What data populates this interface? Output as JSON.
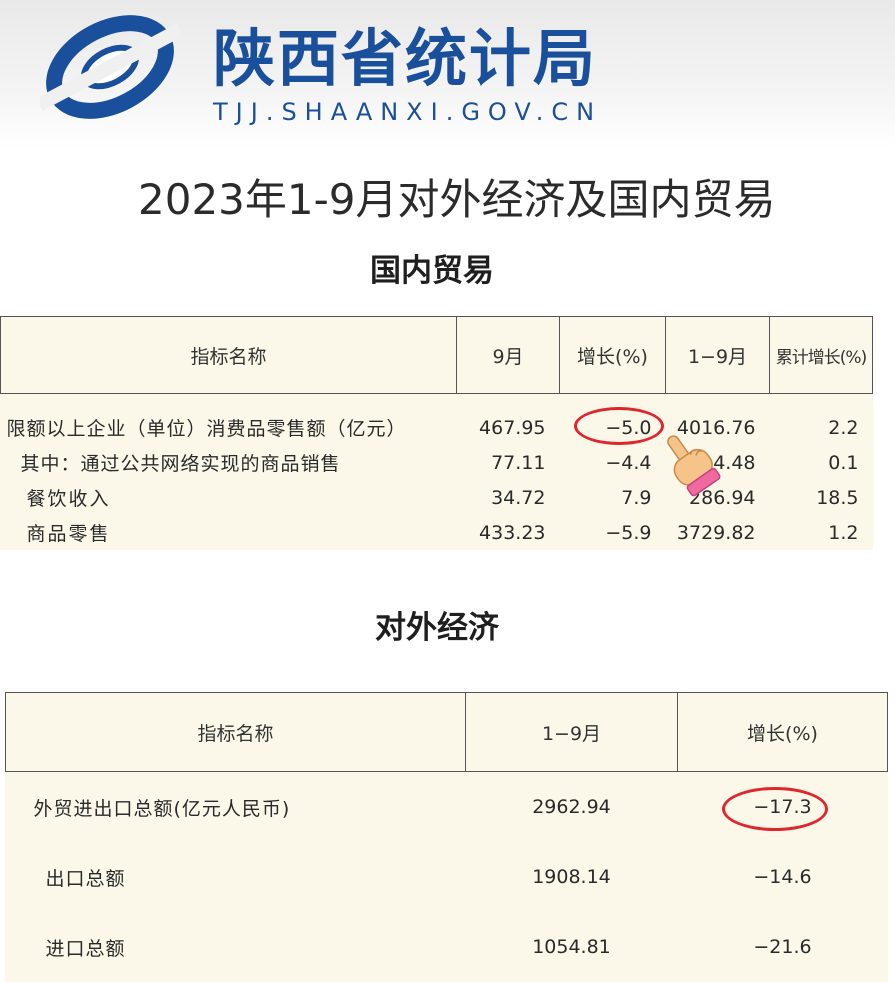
{
  "header": {
    "org_name": "陕西省统计局",
    "org_url": "TJJ.SHAANXI.GOV.CN",
    "logo_icon": "shaanxi-statistics-logo",
    "brand_color": "#1a4f9c"
  },
  "document": {
    "title": "2023年1-9月对外经济及国内贸易"
  },
  "domestic_trade": {
    "section_title": "国内贸易",
    "columns": [
      "指标名称",
      "9月",
      "增长(%)",
      "1−9月",
      "累计增长(%)"
    ],
    "rows": [
      {
        "name": "限额以上企业（单位）消费品零售额（亿元）",
        "sep": "467.95",
        "sep_growth": "−5.0",
        "ytd": "4016.76",
        "ytd_growth": "2.2"
      },
      {
        "name": "其中：通过公共网络实现的商品销售",
        "sep": "77.11",
        "sep_growth": "−4.4",
        "ytd": "714.48",
        "ytd_growth": "0.1"
      },
      {
        "name": "餐饮收入",
        "sep": "34.72",
        "sep_growth": "7.9",
        "ytd": "286.94",
        "ytd_growth": "18.5"
      },
      {
        "name": "商品零售",
        "sep": "433.23",
        "sep_growth": "−5.9",
        "ytd": "3729.82",
        "ytd_growth": "1.2"
      }
    ]
  },
  "foreign_economy": {
    "section_title": "对外经济",
    "columns": [
      "指标名称",
      "1−9月",
      "增长(%)"
    ],
    "rows": [
      {
        "name": "外贸进出口总额(亿元人民币)",
        "ytd": "2962.94",
        "growth": "−17.3"
      },
      {
        "name": "出口总额",
        "ytd": "1908.14",
        "growth": "−14.6"
      },
      {
        "name": "进口总额",
        "ytd": "1054.81",
        "growth": "−21.6"
      }
    ]
  },
  "annotations": {
    "highlight_color": "#e0262d",
    "pointer_icon": "pointing-hand-icon"
  }
}
